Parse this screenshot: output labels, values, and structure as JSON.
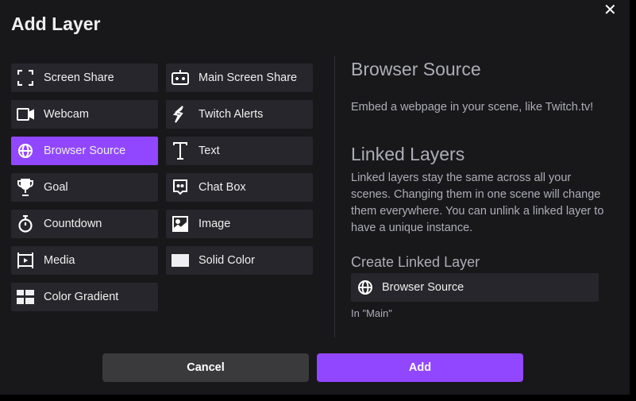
{
  "dialog": {
    "title": "Add Layer",
    "close_icon": "close-icon"
  },
  "layers": [
    {
      "label": "Screen Share",
      "icon": "screen-share-icon"
    },
    {
      "label": "Main Screen Share",
      "icon": "game-controller-icon"
    },
    {
      "label": "Webcam",
      "icon": "webcam-icon"
    },
    {
      "label": "Twitch Alerts",
      "icon": "alert-bolt-icon"
    },
    {
      "label": "Browser Source",
      "icon": "globe-icon",
      "selected": true
    },
    {
      "label": "Text",
      "icon": "text-icon"
    },
    {
      "label": "Goal",
      "icon": "trophy-icon"
    },
    {
      "label": "Chat Box",
      "icon": "chat-icon"
    },
    {
      "label": "Countdown",
      "icon": "stopwatch-icon"
    },
    {
      "label": "Image",
      "icon": "image-icon"
    },
    {
      "label": "Media",
      "icon": "media-icon"
    },
    {
      "label": "Solid Color",
      "icon": "solid-color-icon"
    },
    {
      "label": "Color Gradient",
      "icon": "gradient-grid-icon"
    }
  ],
  "detail": {
    "title": "Browser Source",
    "description": "Embed a webpage in your scene, like Twitch.tv!",
    "linked_title": "Linked Layers",
    "linked_text": "Linked layers stay the same across all your scenes. Changing them in one scene will change them everywhere. You can unlink a linked layer to have a unique instance.",
    "create_title": "Create Linked Layer",
    "linked_item": "Browser Source",
    "scene_note": "In \"Main\""
  },
  "buttons": {
    "cancel": "Cancel",
    "add": "Add"
  },
  "colors": {
    "accent": "#9147ff",
    "background": "#18181b",
    "tile": "#26262c"
  }
}
